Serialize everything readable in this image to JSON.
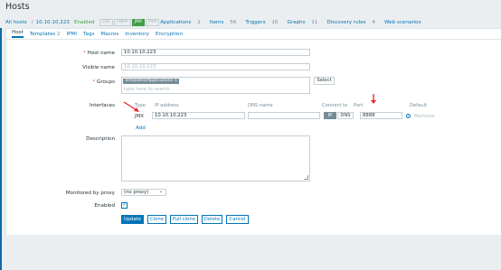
{
  "page": {
    "title": "Hosts"
  },
  "breadcrumb": {
    "all_hosts": "All hosts",
    "sep": "/",
    "host": "10.10.10.223",
    "status": "Enabled",
    "avail": [
      "ZBX",
      "SNMP",
      "JMX",
      "IPMI"
    ],
    "links": [
      {
        "label": "Applications",
        "count": "2"
      },
      {
        "label": "Items",
        "count": "56"
      },
      {
        "label": "Triggers",
        "count": "16"
      },
      {
        "label": "Graphs",
        "count": "11"
      },
      {
        "label": "Discovery rules",
        "count": "4"
      },
      {
        "label": "Web scenarios",
        "count": ""
      }
    ]
  },
  "tabs": [
    {
      "label": "Host",
      "count": ""
    },
    {
      "label": "Templates",
      "count": "2"
    },
    {
      "label": "IPMI",
      "count": ""
    },
    {
      "label": "Tags",
      "count": ""
    },
    {
      "label": "Macros",
      "count": ""
    },
    {
      "label": "Inventory",
      "count": ""
    },
    {
      "label": "Encryption",
      "count": ""
    }
  ],
  "form": {
    "host_name": {
      "label": "Host name",
      "required": "*",
      "value": "10.10.10.223"
    },
    "visible_name": {
      "label": "Visible name",
      "placeholder": "10.10.10.223"
    },
    "groups": {
      "label": "Groups",
      "required": "*",
      "tag": "Templates/Applications",
      "tag_close": "×",
      "placeholder": "type here to search",
      "select_label": "Select"
    },
    "interfaces": {
      "label": "Interfaces",
      "headers": {
        "type": "Type",
        "ip": "IP address",
        "dns": "DNS name",
        "connect": "Connect to",
        "port": "Port",
        "default": "Default"
      },
      "row": {
        "type": "JMX",
        "ip": "10.10.10.223",
        "dns": "",
        "connect_ip": "IP",
        "connect_dns": "DNS",
        "port": "8888",
        "remove": "Remove"
      },
      "add": "Add"
    },
    "description": {
      "label": "Description",
      "value": ""
    },
    "proxy": {
      "label": "Monitored by proxy",
      "value": "(no proxy)",
      "caret": "⌄"
    },
    "enabled": {
      "label": "Enabled",
      "check": "✓"
    }
  },
  "buttons": {
    "update": "Update",
    "clone": "Clone",
    "full_clone": "Full clone",
    "delete": "Delete",
    "cancel": "Cancel"
  },
  "colors": {
    "accent": "#0275b8",
    "annotation": "#e8272a",
    "enabled": "#429e47"
  }
}
